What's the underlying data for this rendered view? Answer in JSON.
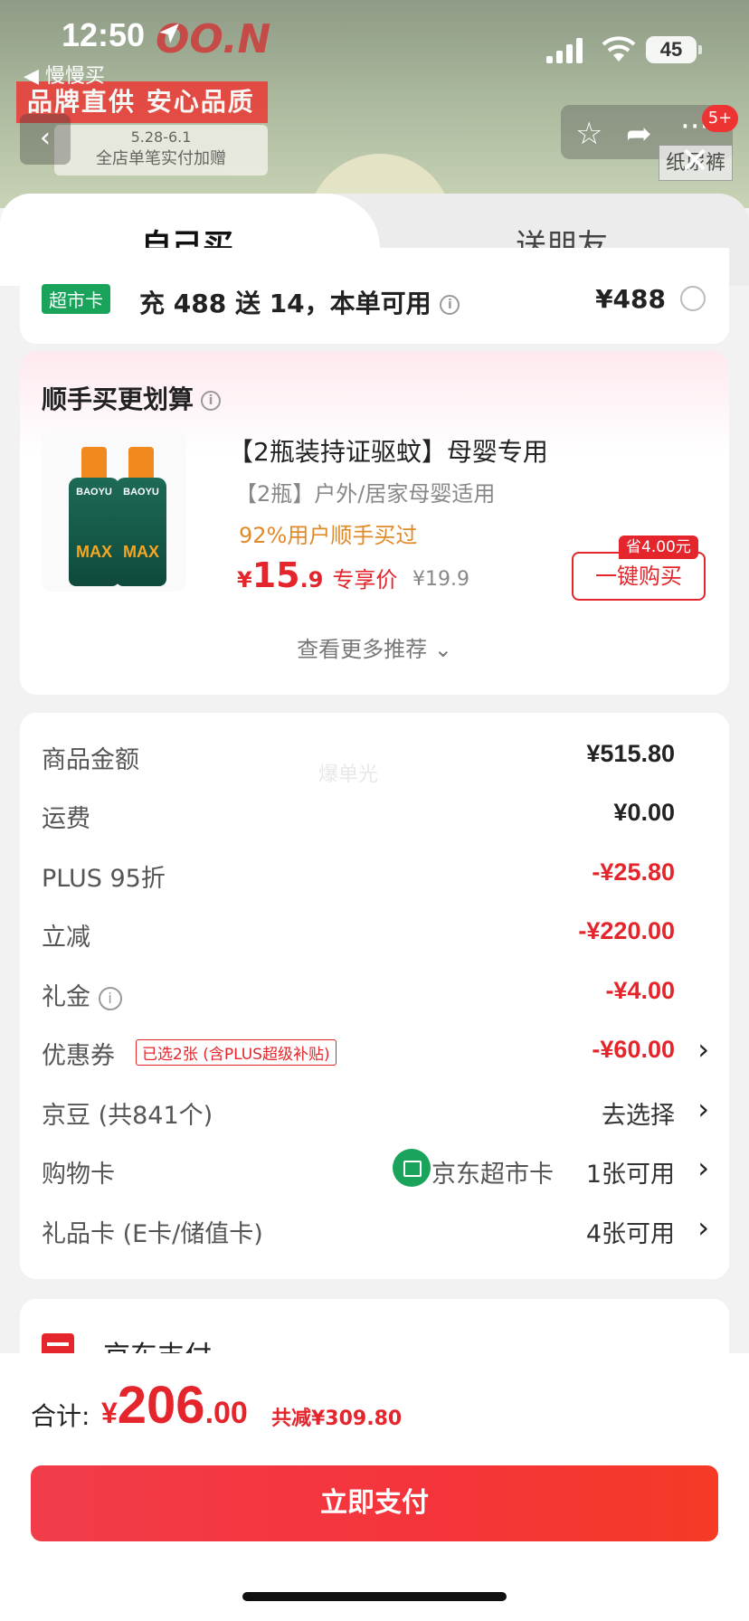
{
  "status_bar": {
    "time": "12:50",
    "back_app": "◀ 慢慢买",
    "battery": "45"
  },
  "background": {
    "brand": "OO.N",
    "banner_text": "品牌直供 安心品质",
    "promo_date": "5.28-6.1",
    "promo_text": "全店单笔实付加赠",
    "badge": "5+",
    "side_tag": "纸尿裤"
  },
  "tabs": [
    {
      "label": "自己买",
      "active": true
    },
    {
      "label": "送朋友",
      "active": false
    }
  ],
  "coupon_row": {
    "tag": "超市卡",
    "text": "充 488 送 14，本单可用",
    "price": "¥488"
  },
  "recommendation": {
    "title": "顺手买更划算",
    "product": {
      "brand_text": "BAOYU",
      "max_text": "MAX",
      "name": "【2瓶装持证驱蚊】母婴专用",
      "subtitle": "【2瓶】户外/居家母婴适用",
      "hot": "92%用户顺手买过",
      "price_currency": "¥",
      "price_int": "15",
      "price_dec": ".9",
      "price_tag": "专享价",
      "original_price": "¥19.9",
      "save_badge": "省4.00元",
      "buy_button": "一键购买"
    },
    "more": "查看更多推荐 ⌄"
  },
  "details": {
    "watermark": "爆单光",
    "rows": [
      {
        "label": "商品金额",
        "value": "¥515.80"
      },
      {
        "label": "运费",
        "value": "¥0.00"
      },
      {
        "label": "PLUS 95折",
        "value": "-¥25.80"
      },
      {
        "label": "立减",
        "value": "-¥220.00"
      },
      {
        "label": "礼金",
        "value": "-¥4.00"
      },
      {
        "label": "优惠券",
        "tag": "已选2张 (含PLUS超级补贴)",
        "value": "-¥60.00"
      },
      {
        "label": "京豆 (共841个)",
        "value": "去选择"
      },
      {
        "label": "购物卡",
        "card_name": "京东超市卡",
        "value": "1张可用"
      },
      {
        "label": "礼品卡 (E卡/储值卡)",
        "value": "4张可用"
      }
    ]
  },
  "payment": {
    "label": "京东支付"
  },
  "footer": {
    "total_label": "合计:",
    "currency": "¥",
    "total_int": "206",
    "total_dec": ".00",
    "total_save": "共减¥309.80",
    "pay_button": "立即支付"
  },
  "colors": {
    "accent_red": "#e4262c",
    "green": "#1aa35a",
    "orange": "#e08a28"
  }
}
